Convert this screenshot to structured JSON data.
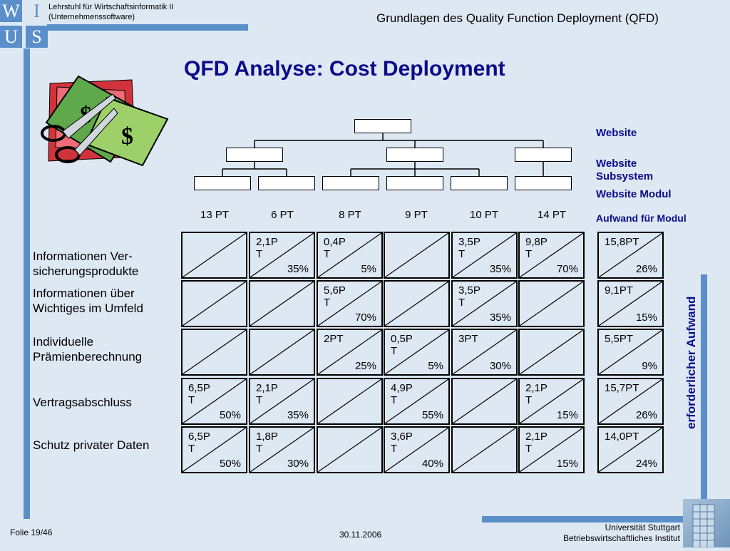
{
  "header": {
    "chair_line1": "Lehrstuhl für Wirtschaftsinformatik II",
    "chair_line2": "(Unternehmenssoftware)",
    "title": "Grundlagen des Quality Function Deployment (QFD)"
  },
  "logo": {
    "w": "W",
    "i": "I",
    "u": "U",
    "s": "S"
  },
  "slide": {
    "title": "QFD Analyse: Cost Deployment"
  },
  "hierarchy": {
    "module_costs": [
      "13 PT",
      "6 PT",
      "8 PT",
      "9 PT",
      "10 PT",
      "14 PT"
    ]
  },
  "legend": {
    "website": "Website",
    "subsystem_line1": "Website",
    "subsystem_line2": "Subsystem",
    "module": "Website Modul",
    "effort": "Aufwand für  Modul"
  },
  "rows": [
    {
      "label_line1": "Informationen Ver-",
      "label_line2": "sicherungsprodukte"
    },
    {
      "label_line1": "Informationen über",
      "label_line2": "Wichtiges im Umfeld"
    },
    {
      "label_line1": "Individuelle",
      "label_line2": "Prämienberechnung"
    },
    {
      "label_line1": "Vertragsabschluss",
      "label_line2": ""
    },
    {
      "label_line1": "Schutz privater Daten",
      "label_line2": ""
    }
  ],
  "matrix": [
    [
      null,
      {
        "v": "2,1PT",
        "p": "35%"
      },
      {
        "v": "0,4PT",
        "p": "5%"
      },
      null,
      {
        "v": "3,5PT",
        "p": "35%"
      },
      {
        "v": "9,8PT",
        "p": "70%"
      }
    ],
    [
      null,
      null,
      {
        "v": "5,6PT",
        "p": "70%"
      },
      null,
      {
        "v": "3,5PT",
        "p": "35%"
      },
      null
    ],
    [
      null,
      null,
      {
        "v": "2PT",
        "p": "25%"
      },
      {
        "v": "0,5PT",
        "p": "5%"
      },
      {
        "v": "3PT",
        "p": "30%"
      },
      null
    ],
    [
      {
        "v": "6,5PT",
        "p": "50%"
      },
      {
        "v": "2,1PT",
        "p": "35%"
      },
      null,
      {
        "v": "4,9PT",
        "p": "55%"
      },
      null,
      {
        "v": "2,1PT",
        "p": "15%"
      }
    ],
    [
      {
        "v": "6,5PT",
        "p": "50%"
      },
      {
        "v": "1,8PT",
        "p": "30%"
      },
      null,
      {
        "v": "3,6PT",
        "p": "40%"
      },
      null,
      {
        "v": "2,1PT",
        "p": "15%"
      }
    ]
  ],
  "totals": [
    {
      "v": "15,8PT",
      "p": "26%"
    },
    {
      "v": "9,1PT",
      "p": "15%"
    },
    {
      "v": "5,5PT",
      "p": "9%"
    },
    {
      "v": "15,7PT",
      "p": "26%"
    },
    {
      "v": "14,0PT",
      "p": "24%"
    }
  ],
  "side_label": "erforderlicher Aufwand",
  "footer": {
    "slide_no": "Folie 19/46",
    "date": "30.11.2006",
    "uni_line1": "Universität Stuttgart",
    "uni_line2": "Betriebswirtschaftliches Institut"
  },
  "colors": {
    "accent": "#5b8fc9",
    "title": "#0b0b8a",
    "background": "#dde8f3"
  }
}
